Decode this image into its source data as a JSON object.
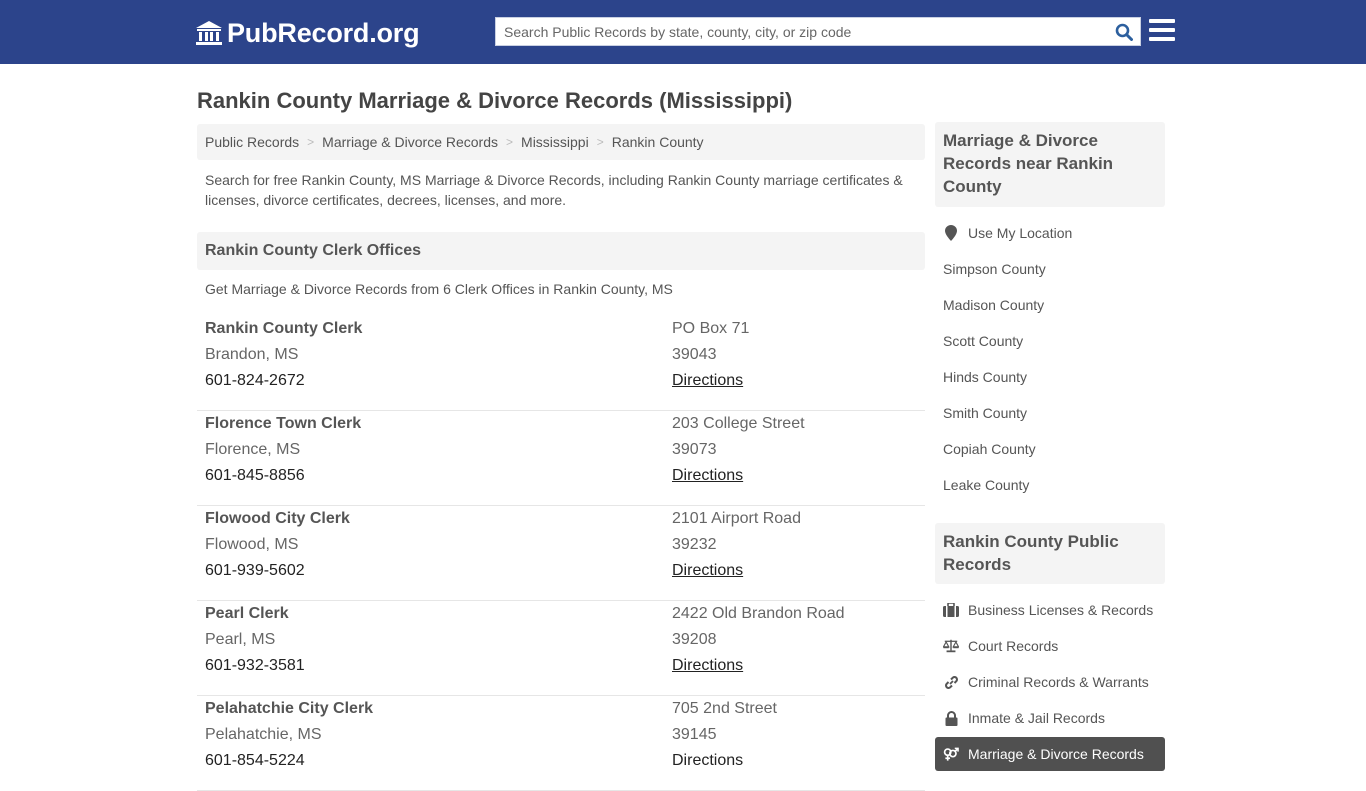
{
  "header": {
    "logo_text": "PubRecord.org",
    "search_placeholder": "Search Public Records by state, county, city, or zip code",
    "search_value": "",
    "brand_color": "#2c448b"
  },
  "page": {
    "title": "Rankin County Marriage & Divorce Records (Mississippi)",
    "breadcrumb": [
      "Public Records",
      "Marriage & Divorce Records",
      "Mississippi",
      "Rankin County"
    ],
    "intro": "Search for free Rankin County, MS Marriage & Divorce Records, including Rankin County marriage certificates & licenses, divorce certificates, decrees, licenses, and more."
  },
  "clerk_section": {
    "heading": "Rankin County Clerk Offices",
    "subheading": "Get Marriage & Divorce Records from 6 Clerk Offices in Rankin County, MS",
    "listings": [
      {
        "name": "Rankin County Clerk",
        "city": "Brandon, MS",
        "phone": "601-824-2672",
        "address": "PO Box 71",
        "zip": "39043",
        "link": "Directions"
      },
      {
        "name": "Florence Town Clerk",
        "city": "Florence, MS",
        "phone": "601-845-8856",
        "address": "203 College Street",
        "zip": "39073",
        "link": "Directions"
      },
      {
        "name": "Flowood City Clerk",
        "city": "Flowood, MS",
        "phone": "601-939-5602",
        "address": "2101 Airport Road",
        "zip": "39232",
        "link": "Directions"
      },
      {
        "name": "Pearl Clerk",
        "city": "Pearl, MS",
        "phone": "601-932-3581",
        "address": "2422 Old Brandon Road",
        "zip": "39208",
        "link": "Directions"
      },
      {
        "name": "Pelahatchie City Clerk",
        "city": "Pelahatchie, MS",
        "phone": "601-854-5224",
        "address": "705 2nd Street",
        "zip": "39145",
        "link": "Directions"
      }
    ]
  },
  "sidebar": {
    "nearby_heading": "Marriage & Divorce Records near Rankin County",
    "use_location": "Use My Location",
    "nearby": [
      "Simpson County",
      "Madison County",
      "Scott County",
      "Hinds County",
      "Smith County",
      "Copiah County",
      "Leake County"
    ],
    "records_heading": "Rankin County Public Records",
    "records": [
      {
        "label": "Business Licenses & Records",
        "icon": "briefcase-icon"
      },
      {
        "label": "Court Records",
        "icon": "scales-icon"
      },
      {
        "label": "Criminal Records & Warrants",
        "icon": "link-icon"
      },
      {
        "label": "Inmate & Jail Records",
        "icon": "lock-icon"
      },
      {
        "label": "Marriage & Divorce Records",
        "icon": "gender-icon",
        "active": true
      }
    ]
  }
}
